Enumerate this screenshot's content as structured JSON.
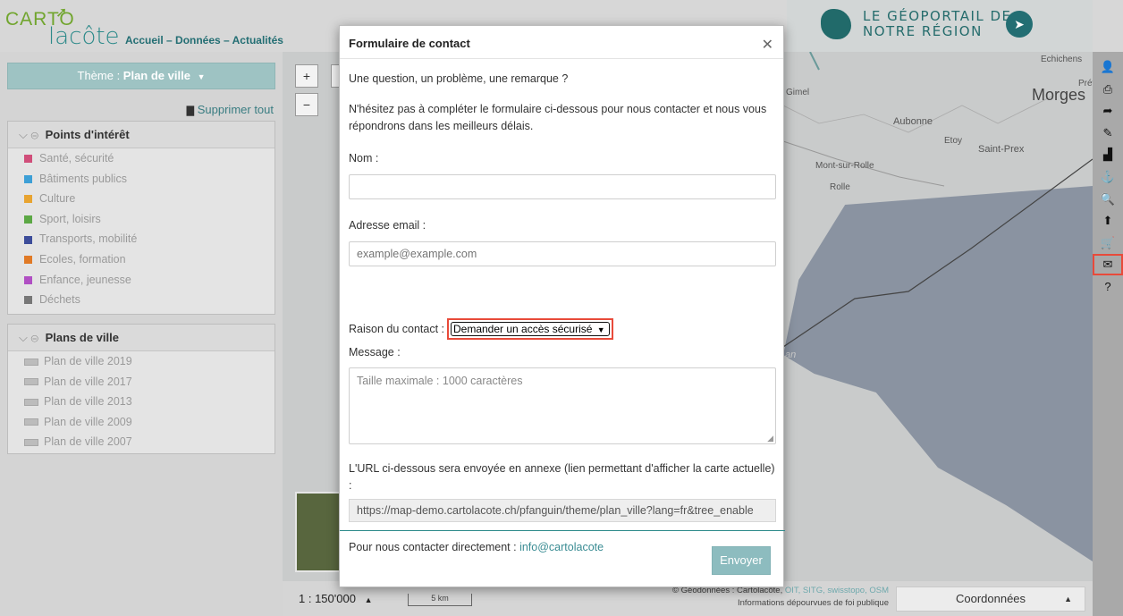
{
  "header": {
    "logo_top": "CARTO",
    "logo_bottom": "lacôte",
    "nav_links": "Accueil – Données – Actualités",
    "portal_title_line1": "LE GÉOPORTAIL DE",
    "portal_title_line2": "NOTRE RÉGION"
  },
  "sidebar": {
    "theme_prefix": "Thème : ",
    "theme_value": "Plan de ville",
    "delete_all": "Supprimer tout",
    "groups": [
      {
        "title": "Points d'intérêt",
        "items": [
          {
            "label": "Santé, sécurité",
            "color": "#d04e7a"
          },
          {
            "label": "Bâtiments publics",
            "color": "#3d9fd6"
          },
          {
            "label": "Culture",
            "color": "#e8a431"
          },
          {
            "label": "Sport, loisirs",
            "color": "#5ca845"
          },
          {
            "label": "Transports, mobilité",
            "color": "#3d4d9a"
          },
          {
            "label": "Ecoles, formation",
            "color": "#e07a26"
          },
          {
            "label": "Enfance, jeunesse",
            "color": "#b04fc3"
          },
          {
            "label": "Déchets",
            "color": "#777777"
          }
        ]
      },
      {
        "title": "Plans de ville",
        "items": [
          {
            "label": "Plan de ville 2019"
          },
          {
            "label": "Plan de ville 2017"
          },
          {
            "label": "Plan de ville 2013"
          },
          {
            "label": "Plan de ville 2009"
          },
          {
            "label": "Plan de ville 2007"
          }
        ]
      }
    ]
  },
  "map": {
    "zoom_in": "+",
    "zoom_out": "−",
    "labels": [
      "Echichens",
      "Prév",
      "Morges",
      "Gimel",
      "Aubonne",
      "Etoy",
      "Saint-Prex",
      "Mont-sur-Rolle",
      "Rolle",
      "an"
    ]
  },
  "bottombar": {
    "scale": "1 : 150'000",
    "scale_bar": "5 km",
    "credits_prefix": "© Géodonnées : Cartolacôte, ",
    "credits_links": "OIT, SITG, swisstopo, OSM",
    "credits_line2": "Informations dépourvues de foi publique",
    "coords": "Coordonnées"
  },
  "toolbar": {
    "icons": [
      "user-icon",
      "print-icon",
      "share-icon",
      "draw-icon",
      "profile-icon",
      "anchor-icon",
      "zoom-search-icon",
      "upload-icon",
      "cart-icon",
      "mail-icon",
      "help-icon"
    ],
    "glyphs": [
      "👤",
      "⎙",
      "➦",
      "✎",
      "▟",
      "⚓",
      "🔍",
      "⬆",
      "🛒",
      "✉",
      "?"
    ],
    "active_index": 9
  },
  "modal": {
    "title": "Formulaire de contact",
    "intro1": "Une question, un problème, une remarque ?",
    "intro2": "N'hésitez pas à compléter le formulaire ci-dessous pour nous contacter et nous vous répondrons dans les meilleurs délais.",
    "name_label": "Nom :",
    "name_value": "",
    "email_label": "Adresse email :",
    "email_placeholder": "example@example.com",
    "reason_label": "Raison du contact :",
    "reason_value": "Demander un accès sécurisé",
    "message_label": "Message :",
    "message_placeholder": "Taille maximale : 1000 caractères",
    "url_note": "L'URL ci-dessous sera envoyée en annexe (lien permettant d'afficher la carte actuelle) :",
    "url_value": "https://map-demo.cartolacote.ch/pfanguin/theme/plan_ville?lang=fr&tree_enable",
    "contact_prefix": "Pour nous contacter directement : ",
    "contact_email": "info@cartolacote",
    "send": "Envoyer"
  },
  "colors": {
    "accent": "#2d8a8a",
    "highlight": "#e84a3a",
    "button": "#8dbcbf"
  }
}
